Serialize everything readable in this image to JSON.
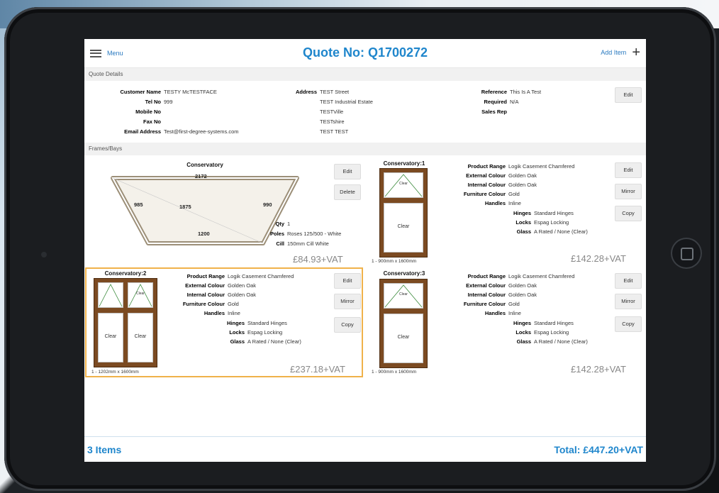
{
  "header": {
    "menu_label": "Menu",
    "title": "Quote No: Q1700272",
    "add_item_label": "Add Item"
  },
  "quote_details": {
    "section_label": "Quote Details",
    "customer_name_label": "Customer Name",
    "customer_name": "TESTY McTESTFACE",
    "tel_label": "Tel No",
    "tel": "999",
    "mobile_label": "Mobile No",
    "mobile": "",
    "fax_label": "Fax No",
    "fax": "",
    "email_label": "Email Address",
    "email": "Test@first-degree-systems.com",
    "address_label": "Address",
    "address_lines": [
      "TEST Street",
      "TEST Industrial Estate",
      "TESTVille",
      "TESTshire",
      "TEST TEST"
    ],
    "reference_label": "Reference",
    "reference": "This Is A Test",
    "required_label": "Required",
    "required": "N/A",
    "sales_rep_label": "Sales Rep",
    "sales_rep": "",
    "edit_label": "Edit"
  },
  "frames": {
    "section_label": "Frames/Bays",
    "bay": {
      "title": "Conservatory",
      "dims": {
        "top": "2172",
        "left": "985",
        "middle": "1875",
        "right": "990",
        "bottom": "1200"
      },
      "qty_label": "Qty",
      "qty": "1",
      "poles_label": "Poles",
      "poles": "Roses 125/500 - White",
      "cill_label": "Cill",
      "cill": "150mm Cill White",
      "price": "£84.93+VAT",
      "edit_label": "Edit",
      "delete_label": "Delete"
    },
    "items": [
      {
        "title": "Conservatory:1",
        "pane_label": "Clear",
        "top_pane_label": "Clear",
        "size": "1 - 900mm x 1600mm",
        "product_range_label": "Product Range",
        "product_range": "Logik Casement Chamfered",
        "ext_colour_label": "External Colour",
        "ext_colour": "Golden Oak",
        "int_colour_label": "Internal Colour",
        "int_colour": "Golden Oak",
        "furniture_label": "Furniture Colour",
        "furniture": "Gold",
        "handles_label": "Handles",
        "handles": "Inline",
        "hinges_label": "Hinges",
        "hinges": "Standard Hinges",
        "locks_label": "Locks",
        "locks": "Espag Locking",
        "glass_label": "Glass",
        "glass": "A Rated / None (Clear)",
        "price": "£142.28+VAT",
        "edit_label": "Edit",
        "mirror_label": "Mirror",
        "copy_label": "Copy"
      },
      {
        "title": "Conservatory:2",
        "pane_label_left": "Clear",
        "pane_label_right": "Clear",
        "top_pane_label": "Clear",
        "size": "1 - 1202mm x 1600mm",
        "product_range_label": "Product Range",
        "product_range": "Logik Casement Chamfered",
        "ext_colour_label": "External Colour",
        "ext_colour": "Golden Oak",
        "int_colour_label": "Internal Colour",
        "int_colour": "Golden Oak",
        "furniture_label": "Furniture Colour",
        "furniture": "Gold",
        "handles_label": "Handles",
        "handles": "Inline",
        "hinges_label": "Hinges",
        "hinges": "Standard Hinges",
        "locks_label": "Locks",
        "locks": "Espag Locking",
        "glass_label": "Glass",
        "glass": "A Rated / None (Clear)",
        "price": "£237.18+VAT",
        "edit_label": "Edit",
        "mirror_label": "Mirror",
        "copy_label": "Copy"
      },
      {
        "title": "Conservatory:3",
        "pane_label": "Clear",
        "top_pane_label": "Clear",
        "size": "1 - 900mm x 1600mm",
        "product_range_label": "Product Range",
        "product_range": "Logik Casement Chamfered",
        "ext_colour_label": "External Colour",
        "ext_colour": "Golden Oak",
        "int_colour_label": "Internal Colour",
        "int_colour": "Golden Oak",
        "furniture_label": "Furniture Colour",
        "furniture": "Gold",
        "handles_label": "Handles",
        "handles": "Inline",
        "hinges_label": "Hinges",
        "hinges": "Standard Hinges",
        "locks_label": "Locks",
        "locks": "Espag Locking",
        "glass_label": "Glass",
        "glass": "A Rated / None (Clear)",
        "price": "£142.28+VAT",
        "edit_label": "Edit",
        "mirror_label": "Mirror",
        "copy_label": "Copy"
      }
    ]
  },
  "footer": {
    "items_count": "3 Items",
    "total": "Total:  £447.20+VAT"
  },
  "colors": {
    "accent": "#1f86cc",
    "frame_wood": "#7b4a21",
    "selection": "#f0b24a"
  }
}
